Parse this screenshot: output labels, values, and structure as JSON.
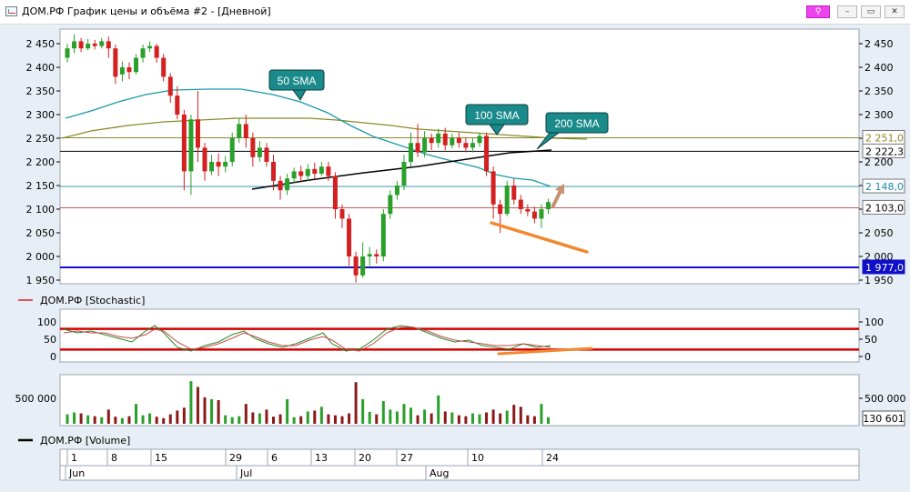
{
  "window": {
    "title": "ДОМ.РФ График цены и объёма #2 - [Дневной]",
    "buttons": {
      "pin": "⚲",
      "minimize": "–",
      "maximize": "▭",
      "close": "✕"
    }
  },
  "panes": {
    "price": {
      "y_ticks": [
        "2 450",
        "2 400",
        "2 350",
        "2 300",
        "2 250",
        "2 200",
        "2 150",
        "2 100",
        "2 050",
        "2 000",
        "1 950"
      ],
      "y_tick_values": [
        2450,
        2400,
        2350,
        2300,
        2250,
        2200,
        2150,
        2100,
        2050,
        2000,
        1950
      ],
      "right_ticks": [
        "2 450",
        "2 400",
        "2 350",
        "2 300",
        "2 250",
        "2 200",
        "2 150",
        "2 100",
        "2 050",
        "2 000",
        "1 950"
      ],
      "price_tags": [
        {
          "text": "2 251,0",
          "value": 2251,
          "color": "#8a8a2a",
          "bg": "#ffffff"
        },
        {
          "text": "2 222,3",
          "value": 2222.3,
          "color": "#000000",
          "bg": "#ffffff"
        },
        {
          "text": "2 148,0",
          "value": 2148,
          "color": "#1a8aa8",
          "bg": "#ffffff"
        },
        {
          "text": "2 103,0",
          "value": 2103,
          "color": "#000000",
          "bg": "#ffffff"
        },
        {
          "text": "1 977,0",
          "value": 1977,
          "color": "#ffffff",
          "bg": "#1010c8"
        }
      ],
      "sma_labels": [
        "50 SMA",
        "100 SMA",
        "200 SMA"
      ],
      "colors": {
        "up": "#2aa02a",
        "down": "#d42020",
        "sma50": "#1a9aaa",
        "sma100": "#8a8a2a",
        "trend": "#000000",
        "blue_line": "#1010c8",
        "marker": "#f08a30"
      }
    },
    "stochastic": {
      "legend": "ДОМ.РФ [Stochastic]",
      "y_ticks": [
        "100",
        "50",
        "0"
      ],
      "levels": [
        80,
        20
      ]
    },
    "volume": {
      "y_tick": "500 000",
      "last_value": "130 601"
    },
    "axis": {
      "legend": "ДОМ.РФ [Volume]",
      "day_labels": [
        "1",
        "8",
        "15",
        "29",
        "6",
        "13",
        "20",
        "27",
        "10",
        "24"
      ],
      "month_labels": [
        "Jun",
        "Jul",
        "Aug"
      ]
    }
  }
}
